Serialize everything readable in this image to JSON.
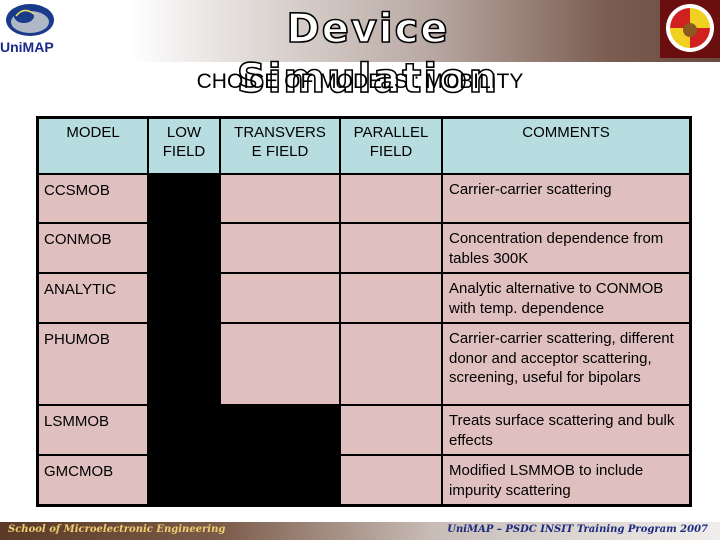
{
  "banner": {
    "title": "Device Simulation",
    "left_logo_text": "UniMAP"
  },
  "slide": {
    "title": "CHOICE OF MODELS : MOBILITY"
  },
  "table": {
    "headers": [
      "MODEL",
      "LOW FIELD",
      "TRANSVERS E FIELD",
      "PARALLEL FIELD",
      "COMMENTS"
    ],
    "rows": [
      {
        "model": "CCSMOB",
        "low_field": true,
        "transverse_field": false,
        "parallel_field": false,
        "comment": "Carrier-carrier scattering"
      },
      {
        "model": "CONMOB",
        "low_field": true,
        "transverse_field": false,
        "parallel_field": false,
        "comment": "Concentration dependence from tables 300K"
      },
      {
        "model": "ANALYTIC",
        "low_field": true,
        "transverse_field": false,
        "parallel_field": false,
        "comment": "Analytic alternative to CONMOB with temp. dependence"
      },
      {
        "model": "PHUMOB",
        "low_field": true,
        "transverse_field": false,
        "parallel_field": false,
        "comment": "Carrier-carrier scattering, different donor and acceptor scattering, screening, useful for bipolars"
      },
      {
        "model": "LSMMOB",
        "low_field": true,
        "transverse_field": true,
        "parallel_field": false,
        "comment": "Treats surface scattering and bulk effects"
      },
      {
        "model": "GMCMOB",
        "low_field": true,
        "transverse_field": true,
        "parallel_field": false,
        "comment": "Modified LSMMOB to include impurity scattering"
      }
    ]
  },
  "footer": {
    "left": "School of Microelectronic Engineering",
    "right": "UniMAP – PSDC INSIT Training Program 2007"
  },
  "colors": {
    "header_bg": "#b7dde0",
    "cell_bg": "#e0c0bf",
    "selected_cell": "#000000"
  }
}
